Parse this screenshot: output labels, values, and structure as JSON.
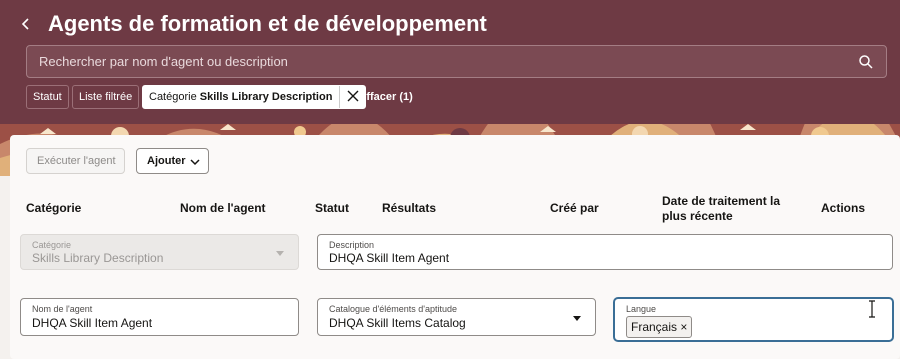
{
  "header": {
    "title": "Agents de formation et de développement",
    "search_placeholder": "Rechercher par nom d'agent ou description",
    "filters": {
      "status": "Statut",
      "filtered_list": "Liste filtrée",
      "category_chip_prefix": "Catégorie",
      "category_chip_value": "Skills Library Description",
      "clear": "Effacer (1)"
    }
  },
  "toolbar": {
    "run_agent": "Exécuter l'agent",
    "add": "Ajouter"
  },
  "table": {
    "columns": {
      "category": "Catégorie",
      "agent_name": "Nom de l'agent",
      "status": "Statut",
      "results": "Résultats",
      "created_by": "Créé par",
      "last_processed_line1": "Date de traitement la",
      "last_processed_line2": "plus récente",
      "actions": "Actions"
    }
  },
  "form": {
    "category": {
      "label": "Catégorie",
      "value": "Skills Library Description"
    },
    "description": {
      "label": "Description",
      "value": "DHQA Skill Item Agent"
    },
    "agent_name": {
      "label": "Nom de l'agent",
      "value": "DHQA Skill Item Agent"
    },
    "catalog": {
      "label": "Catalogue d'éléments d'aptitude",
      "value": "DHQA Skill Items Catalog"
    },
    "language": {
      "label": "Langue",
      "tag": "Français",
      "tag_remove": "×"
    }
  },
  "colors": {
    "header_bg": "#6e3a44",
    "focus_border": "#3a6e96"
  },
  "icons": [
    "back-chevron-icon",
    "search-icon",
    "close-icon",
    "chevron-down-icon",
    "caret-down-icon",
    "text-cursor-icon"
  ]
}
